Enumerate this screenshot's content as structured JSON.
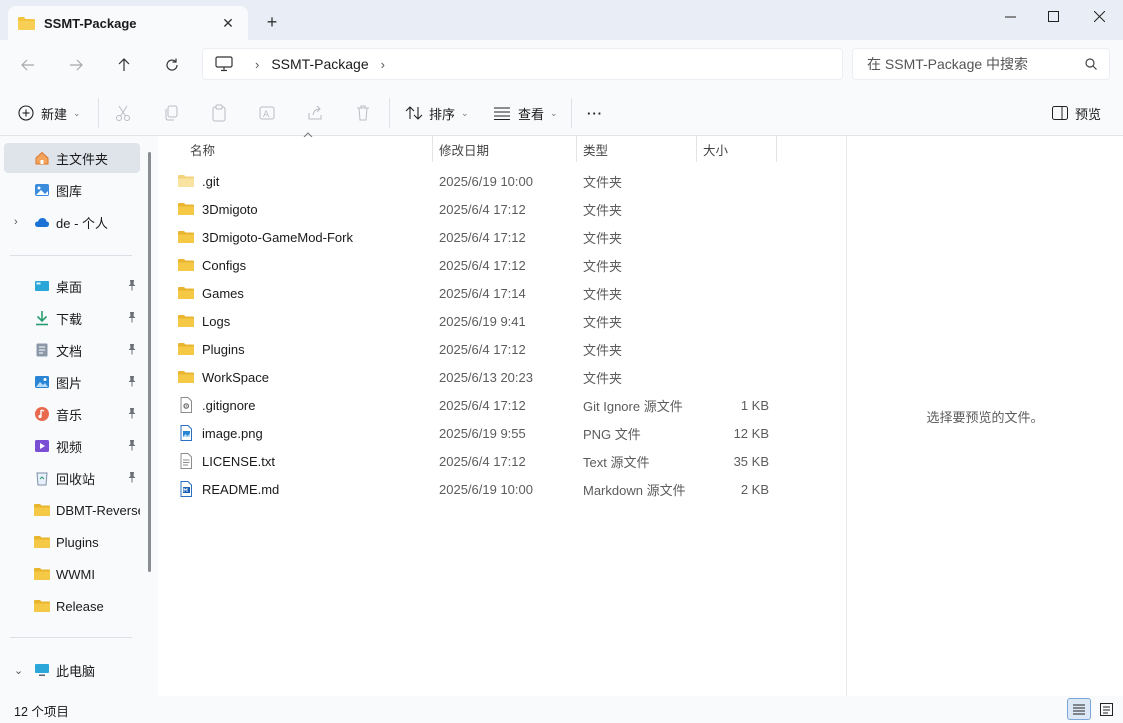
{
  "window": {
    "tab_title": "SSMT-Package",
    "new_tab_symbol": "+",
    "close_tab_symbol": "✕",
    "minimize_symbol": "—",
    "maximize_symbol": "☐",
    "close_symbol": "✕"
  },
  "address_bar": {
    "segments": [
      "SSMT-Package"
    ],
    "search_placeholder": "在 SSMT-Package 中搜索"
  },
  "toolbar": {
    "new_label": "新建",
    "sort_label": "排序",
    "view_label": "查看",
    "more_label": "···",
    "preview_label": "预览"
  },
  "sidebar": {
    "top_items": [
      {
        "label": "主文件夹",
        "icon": "home-icon",
        "selected": true
      },
      {
        "label": "图库",
        "icon": "gallery-icon"
      },
      {
        "label": "de - 个人",
        "icon": "onedrive-cloud-icon",
        "expandable": true
      }
    ],
    "quick_access": [
      {
        "label": "桌面",
        "icon": "desktop-icon",
        "pinned": true
      },
      {
        "label": "下载",
        "icon": "download-icon",
        "pinned": true
      },
      {
        "label": "文档",
        "icon": "documents-icon",
        "pinned": true
      },
      {
        "label": "图片",
        "icon": "pictures-icon",
        "pinned": true
      },
      {
        "label": "音乐",
        "icon": "music-icon",
        "pinned": true
      },
      {
        "label": "视频",
        "icon": "videos-icon",
        "pinned": true
      },
      {
        "label": "回收站",
        "icon": "recycle-bin-icon",
        "pinned": true
      },
      {
        "label": "DBMT-Reverse",
        "icon": "folder-icon"
      },
      {
        "label": "Plugins",
        "icon": "folder-icon"
      },
      {
        "label": "WWMI",
        "icon": "folder-icon"
      },
      {
        "label": "Release",
        "icon": "folder-icon"
      }
    ],
    "this_pc": {
      "label": "此电脑",
      "icon": "this-pc-icon",
      "expanded": true
    }
  },
  "file_list": {
    "columns": {
      "name": "名称",
      "date": "修改日期",
      "type": "类型",
      "size": "大小"
    },
    "rows": [
      {
        "name": ".git",
        "date": "2025/6/19 10:00",
        "type": "文件夹",
        "size": "",
        "icon": "folder-light"
      },
      {
        "name": "3Dmigoto",
        "date": "2025/6/4 17:12",
        "type": "文件夹",
        "size": "",
        "icon": "folder"
      },
      {
        "name": "3Dmigoto-GameMod-Fork",
        "date": "2025/6/4 17:12",
        "type": "文件夹",
        "size": "",
        "icon": "folder"
      },
      {
        "name": "Configs",
        "date": "2025/6/4 17:12",
        "type": "文件夹",
        "size": "",
        "icon": "folder"
      },
      {
        "name": "Games",
        "date": "2025/6/4 17:14",
        "type": "文件夹",
        "size": "",
        "icon": "folder"
      },
      {
        "name": "Logs",
        "date": "2025/6/19 9:41",
        "type": "文件夹",
        "size": "",
        "icon": "folder"
      },
      {
        "name": "Plugins",
        "date": "2025/6/4 17:12",
        "type": "文件夹",
        "size": "",
        "icon": "folder"
      },
      {
        "name": "WorkSpace",
        "date": "2025/6/13 20:23",
        "type": "文件夹",
        "size": "",
        "icon": "folder"
      },
      {
        "name": ".gitignore",
        "date": "2025/6/4 17:12",
        "type": "Git Ignore 源文件",
        "size": "1 KB",
        "icon": "gear-file"
      },
      {
        "name": "image.png",
        "date": "2025/6/19 9:55",
        "type": "PNG 文件",
        "size": "12 KB",
        "icon": "image-file"
      },
      {
        "name": "LICENSE.txt",
        "date": "2025/6/4 17:12",
        "type": "Text 源文件",
        "size": "35 KB",
        "icon": "text-file"
      },
      {
        "name": "README.md",
        "date": "2025/6/19 10:00",
        "type": "Markdown 源文件",
        "size": "2 KB",
        "icon": "markdown-file"
      }
    ]
  },
  "preview_pane": {
    "message": "选择要预览的文件。"
  },
  "status_bar": {
    "item_count": "12 个项目"
  },
  "colors": {
    "folder": "#f3c43e",
    "folder_light": "#f8dc8a",
    "accent": "#0067c0",
    "selected_bg": "#dfe3ea"
  }
}
